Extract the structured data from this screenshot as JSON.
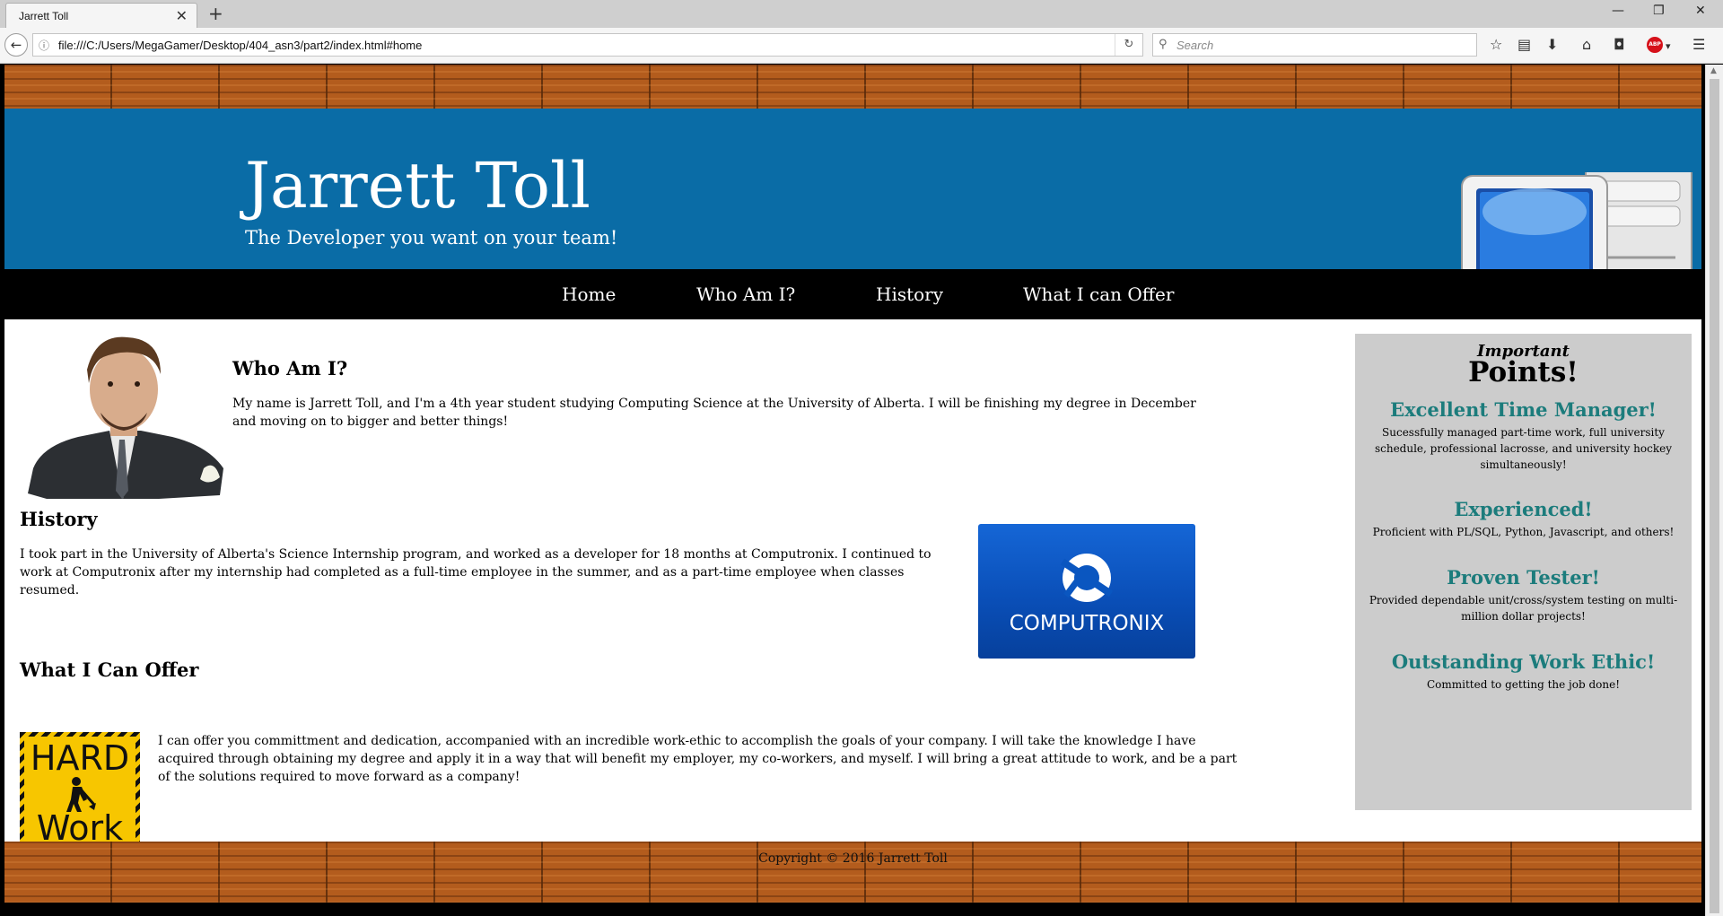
{
  "browser": {
    "tab_title": "Jarrett Toll",
    "tab_close": "✕",
    "new_tab": "+",
    "window_controls": {
      "minimize": "—",
      "restore": "❐",
      "close": "✕"
    },
    "back_icon": "←",
    "url_info_icon": "ⓘ",
    "url": "file:///C:/Users/MegaGamer/Desktop/404_asn3/part2/index.html#home",
    "reload_icon": "↻",
    "search_icon": "⚲",
    "search_placeholder": "Search",
    "toolbar_icons": {
      "bookmark": "☆",
      "library": "▤",
      "download": "⬇",
      "home": "⌂",
      "pocket": "◘",
      "menu": "☰",
      "dropdown": "▾"
    },
    "adblock_label": "ABP"
  },
  "header": {
    "site_name": "Jarrett Toll",
    "tagline": "The Developer you want on your team!"
  },
  "nav": {
    "items": [
      {
        "label": "Home"
      },
      {
        "label": "Who Am I?"
      },
      {
        "label": "History"
      },
      {
        "label": "What I can Offer"
      }
    ]
  },
  "sections": {
    "who": {
      "title": "Who Am I?",
      "text": "My name is Jarrett Toll, and I'm a 4th year student studying Computing Science at the University of Alberta. I will be finishing my degree in December and moving on to bigger and better things!"
    },
    "history": {
      "title": "History",
      "text": "I took part in the University of Alberta's Science Internship program, and worked as a developer for 18 months at Computronix. I continued to work at Computronix after my internship had completed as a full-time employee in the summer, and as a part-time employee when classes resumed.",
      "logo_text": "COMPUTRONIX"
    },
    "offer": {
      "title": "What I Can Offer",
      "text": "I can offer you committment and dedication, accompanied with an incredible work-ethic to accomplish the goals of your company. I will take the knowledge I have acquired through obtaining my degree and apply it in a way that will benefit my employer, my co-workers, and myself. I will bring a great attitude to work, and be a part of the solutions required to move forward as a company!",
      "image_word_1": "HARD",
      "image_word_2": "Work"
    }
  },
  "sidebar": {
    "important": "Important",
    "points_title": "Points!",
    "points": [
      {
        "heading": "Excellent Time Manager!",
        "text": "Sucessfully managed part-time work, full university schedule, professional lacrosse, and university hockey simultaneously!"
      },
      {
        "heading": "Experienced!",
        "text": "Proficient with PL/SQL, Python, Javascript, and others!"
      },
      {
        "heading": "Proven Tester!",
        "text": "Provided dependable unit/cross/system testing on multi-million dollar projects!"
      },
      {
        "heading": "Outstanding Work Ethic!",
        "text": "Committed to getting the job done!"
      }
    ]
  },
  "footer": {
    "copyright": "Copyright © 2016 Jarrett Toll"
  },
  "colors": {
    "header_blue": "#0a6ca6",
    "nav_black": "#000000",
    "sidebar_gray": "#cccccc",
    "sidebar_heading_teal": "#1c7c7c",
    "wood_orange": "#b35c1d"
  }
}
